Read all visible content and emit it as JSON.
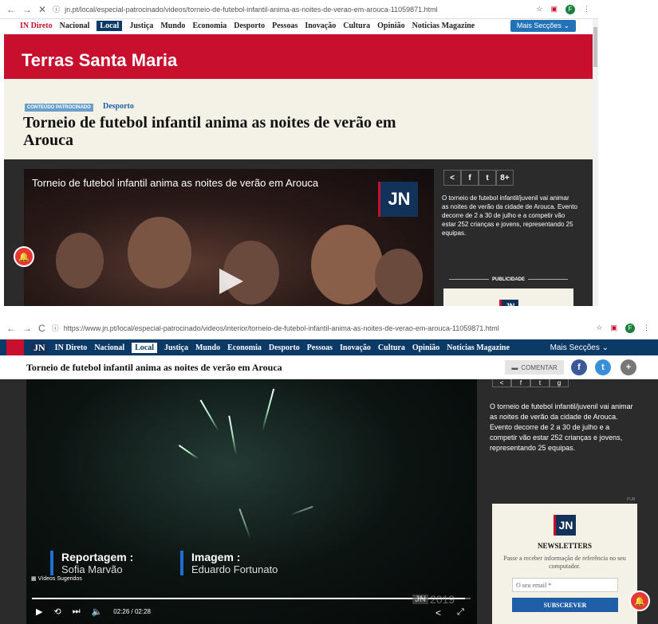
{
  "shot1": {
    "browser": {
      "url": "jn.pt/local/especial-patrocinado/videos/torneio-de-futebol-infantil-anima-as-noites-de-verao-em-arouca-11059871.html",
      "profile_initial": "F"
    },
    "nav": {
      "items": [
        "IN Direto",
        "Nacional",
        "Local",
        "Justiça",
        "Mundo",
        "Economia",
        "Desporto",
        "Pessoas",
        "Inovação",
        "Cultura",
        "Opinião",
        "Notícias Magazine"
      ],
      "more": "Mais Secções"
    },
    "banner_title": "Terras Santa Maria",
    "badge": "CONTEÚDO PATROCINADO",
    "category": "Desporto",
    "title": "Torneio de futebol infantil anima as noites de verão em Arouca",
    "video_title": "Torneio de futebol infantil anima as noites de verão em Arouca",
    "logo": "JN",
    "share": [
      "<",
      "f",
      "t",
      "8+"
    ],
    "description": "O torneio de futebol infantil/juvenil vai animar as noites de verão da cidade de Arouca. Evento decorre de 2 a 30 de julho e a competir vão estar 252 crianças e jovens, representando 25 equipas.",
    "publicidade": "PUBLICIDADE"
  },
  "shot2": {
    "browser": {
      "url": "https://www.jn.pt/local/especial-patrocinado/videos/interior/torneio-de-futebol-infantil-anima-as-noites-de-verao-em-arouca-11059871.html",
      "profile_initial": "F"
    },
    "nav": {
      "logo": "JN",
      "items": [
        "IN Direto",
        "Nacional",
        "Local",
        "Justiça",
        "Mundo",
        "Economia",
        "Desporto",
        "Pessoas",
        "Inovação",
        "Cultura",
        "Opinião",
        "Notícias Magazine"
      ],
      "more": "Mais Secções"
    },
    "sticky_title": "Torneio de futebol infantil anima as noites de verão em Arouca",
    "comment": "COMENTAR",
    "credits": [
      {
        "key": "Reportagem :",
        "value": "Sofia Marvão"
      },
      {
        "key": "Imagem :",
        "value": "Eduardo Fortunato"
      }
    ],
    "suggested": "Vídeos Sugeridos",
    "time": "02:26 / 02:28",
    "progress": 0.987,
    "watermark": "2019",
    "description": "O torneio de futebol infantil/juvenil vai animar as noites de verão da cidade de Arouca. Evento decorre de 2 a 30 de julho e a competir vão estar 252 crianças e jovens, representando 25 equipas.",
    "pub": "PUB",
    "newsletter": {
      "logo": "JN",
      "title": "NEWSLETTERS",
      "subtitle": "Passe a receber informação de referência no seu computador.",
      "placeholder": "O seu email *",
      "button": "SUBSCREVER"
    }
  }
}
